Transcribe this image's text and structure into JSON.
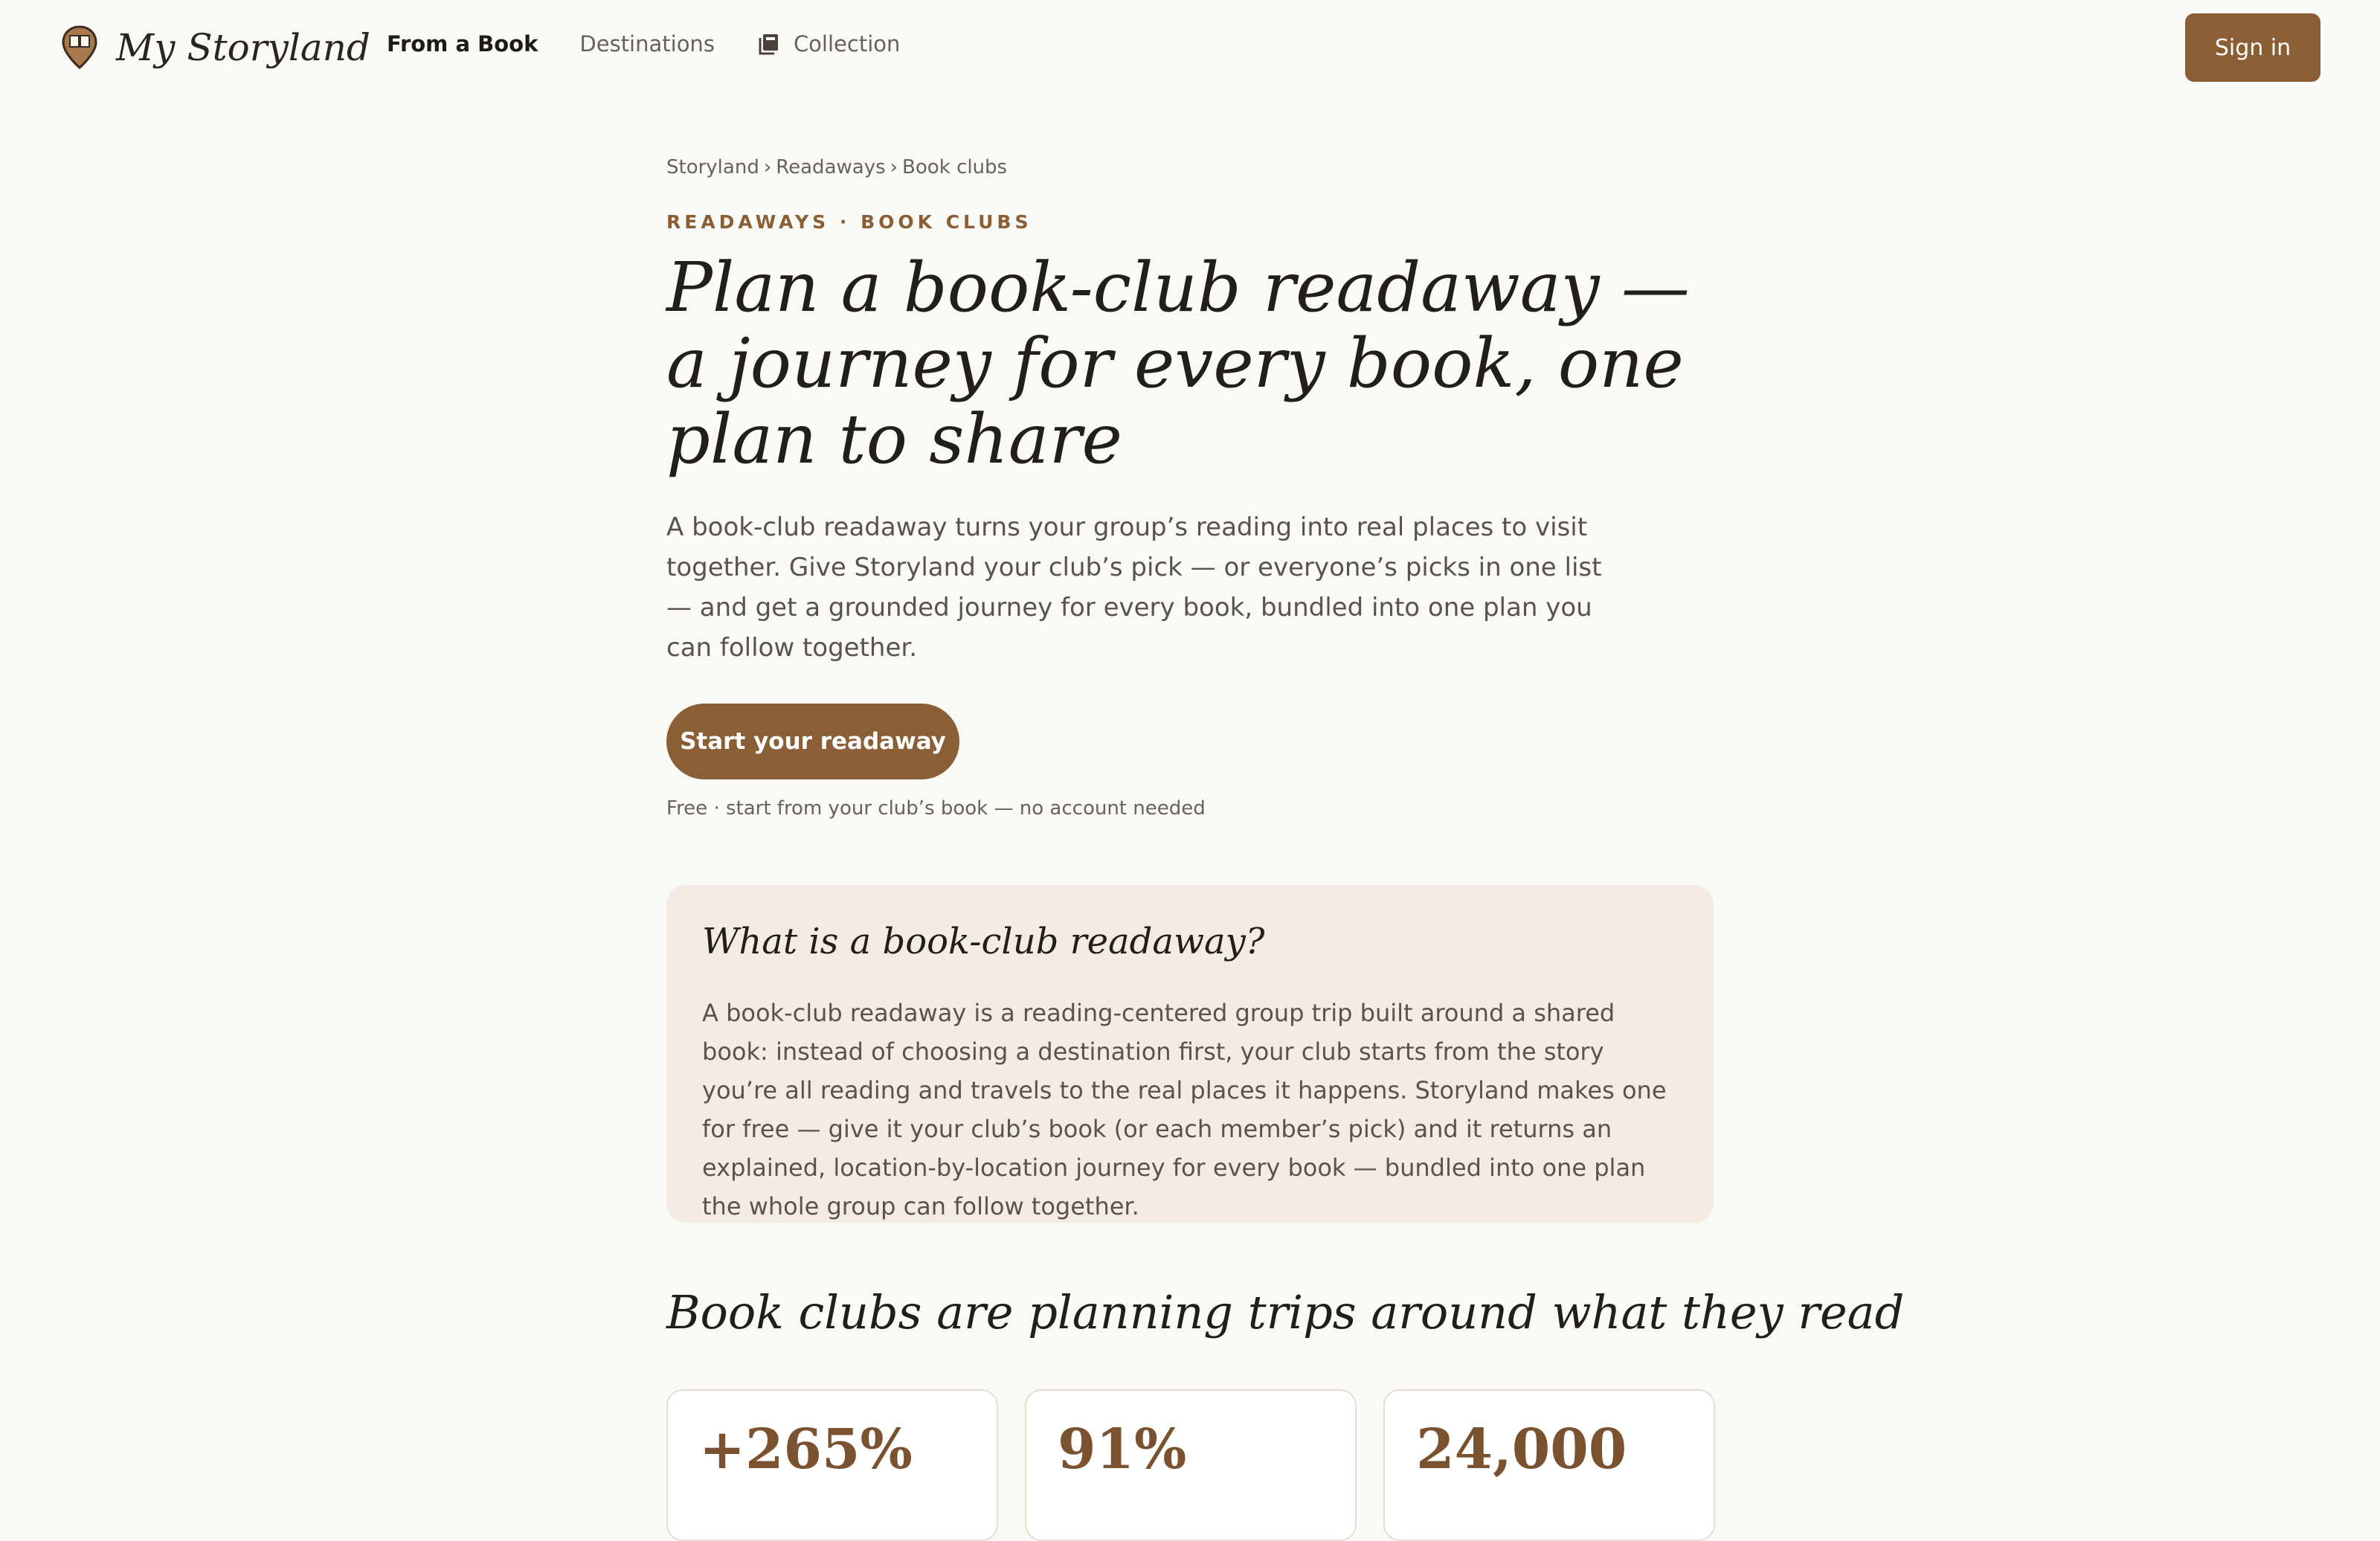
{
  "brand": {
    "name": "My Storyland"
  },
  "nav": {
    "items": [
      {
        "label": "From a Book",
        "active": true
      },
      {
        "label": "Destinations",
        "active": false
      },
      {
        "label": "Collection",
        "active": false,
        "icon": "collection-icon"
      }
    ],
    "sign_in": "Sign in"
  },
  "breadcrumb": [
    "Storyland",
    "Readaways",
    "Book clubs"
  ],
  "eyebrow": "READAWAYS · BOOK CLUBS",
  "hero": {
    "title": "Plan a book-club readaway — a journey for every book, one plan to share",
    "description": "A book-club readaway turns your group’s reading into real places to visit together. Give Storyland your club’s pick — or everyone’s picks in one list — and get a grounded journey for every book, bundled into one plan you can follow together.",
    "cta": "Start your readaway",
    "note": "Free · start from your club’s book — no account needed"
  },
  "info": {
    "title": "What is a book-club readaway?",
    "body": "A book-club readaway is a reading-centered group trip built around a shared book: instead of choosing a destination first, your club starts from the story you’re all reading and travels to the real places it happens. Storyland makes one for free — give it your club’s book (or each member’s pick) and it returns an explained, location-by-location journey for every book — bundled into one plan the whole group can follow together."
  },
  "stats": {
    "heading": "Book clubs are planning trips around what they read",
    "items": [
      {
        "value": "+265%"
      },
      {
        "value": "91%"
      },
      {
        "value": "24,000"
      }
    ]
  },
  "colors": {
    "accent": "#8a5f35",
    "background": "#f9f9f6",
    "card": "#f4ebe5"
  }
}
